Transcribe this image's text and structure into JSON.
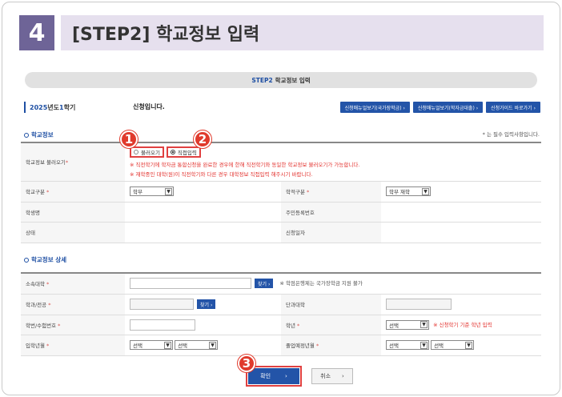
{
  "step": {
    "number": "4",
    "title": "[STEP2] 학교정보 입력"
  },
  "banner": {
    "step": "STEP2",
    "title": "학교정보 입력"
  },
  "term": {
    "year": "2025",
    "year_suffix": "년도 ",
    "sem": "1",
    "sem_suffix": "학기",
    "apply_text": "신청입니다."
  },
  "top_buttons": [
    "신청매뉴얼보기(국가장학금) ›",
    "신청매뉴얼보기(학자금대출) ›",
    "신청가이드 바로가기 ›"
  ],
  "school_info": {
    "title": "학교정보",
    "required_note": "* 는 필수 입력사항입니다.",
    "load_label": "학교정보 불러오기",
    "radio_load": "불러오기",
    "radio_direct": "직접입력",
    "notice1": "※ 직전학기에 학자금 통합신청을 완료한 경우에 한해 직전학기와 동일한 학교정보 불러오기가 가능합니다.",
    "notice2": "※ 재학중인 대학(원)이 직전학기와 다른 경우 대학정보 직접입력 해주시기 바랍니다.",
    "school_type_label": "학교구분",
    "school_type_value": "학부",
    "record_label": "학적구분",
    "record_value": "학부 재학",
    "student_name_label": "학생명",
    "resident_label": "주민등록번호",
    "status_label": "상태",
    "apply_date_label": "신청일자"
  },
  "school_detail": {
    "title": "학교정보 상세",
    "univ_label": "소속대학",
    "search_label": "찾기 ›",
    "univ_note": "※ 학점은행제는 국가장학금 지원 불가",
    "dept_label": "학과/전공",
    "college_label": "단과대학",
    "student_no_label": "학번/수험번호",
    "grade_label": "학년",
    "grade_value": "선택",
    "grade_note": "※ 신청학기 기준 학년 입력",
    "entry_label": "입학년월",
    "grad_label": "졸업예정년월",
    "select_text": "선택"
  },
  "buttons": {
    "confirm": "확인",
    "cancel": "취소",
    "arrow": "›"
  },
  "badges": [
    "1",
    "2",
    "3"
  ],
  "colors": {
    "accent": "#2354a8",
    "step": "#6e6497",
    "badge": "#e03a2c"
  }
}
